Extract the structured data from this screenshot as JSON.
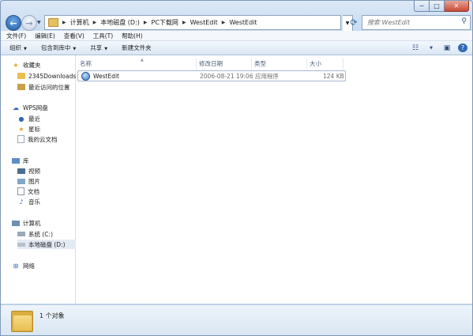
{
  "window": {
    "controls": {
      "minimize": "─",
      "maximize": "□",
      "close": "✕"
    }
  },
  "address": {
    "crumbs": [
      "计算机",
      "本地磁盘 (D:)",
      "PC下载网",
      "WestEdit",
      "WestEdit"
    ],
    "search_placeholder": "搜索 WestEdit"
  },
  "menu": [
    "文件(F)",
    "编辑(E)",
    "查看(V)",
    "工具(T)",
    "帮助(H)"
  ],
  "toolbar": {
    "organize": "组织",
    "include_in_library": "包含到库中",
    "share": "共享",
    "new_folder": "新建文件夹"
  },
  "nav": {
    "favorites": {
      "label": "收藏夹",
      "items": [
        "2345Downloads",
        "最近访问的位置"
      ]
    },
    "wps": {
      "label": "WPS网盘",
      "items": [
        "最近",
        "星标",
        "我的云文档"
      ]
    },
    "library": {
      "label": "库",
      "items": [
        "视频",
        "图片",
        "文档",
        "音乐"
      ]
    },
    "computer": {
      "label": "计算机",
      "items": [
        "系统 (C:)",
        "本地磁盘 (D:)"
      ]
    },
    "network": {
      "label": "网络"
    }
  },
  "columns": [
    "名称",
    "修改日期",
    "类型",
    "大小"
  ],
  "files": [
    {
      "name": "WestEdit",
      "modified": "2006-08-21 19:06",
      "type": "应用程序",
      "size": "124 KB"
    }
  ],
  "status": {
    "count_text": "1 个对象"
  },
  "colors": {
    "folder": "#e8bf53",
    "selection": "#e3eaf3",
    "accent": "#2f6ab3"
  }
}
